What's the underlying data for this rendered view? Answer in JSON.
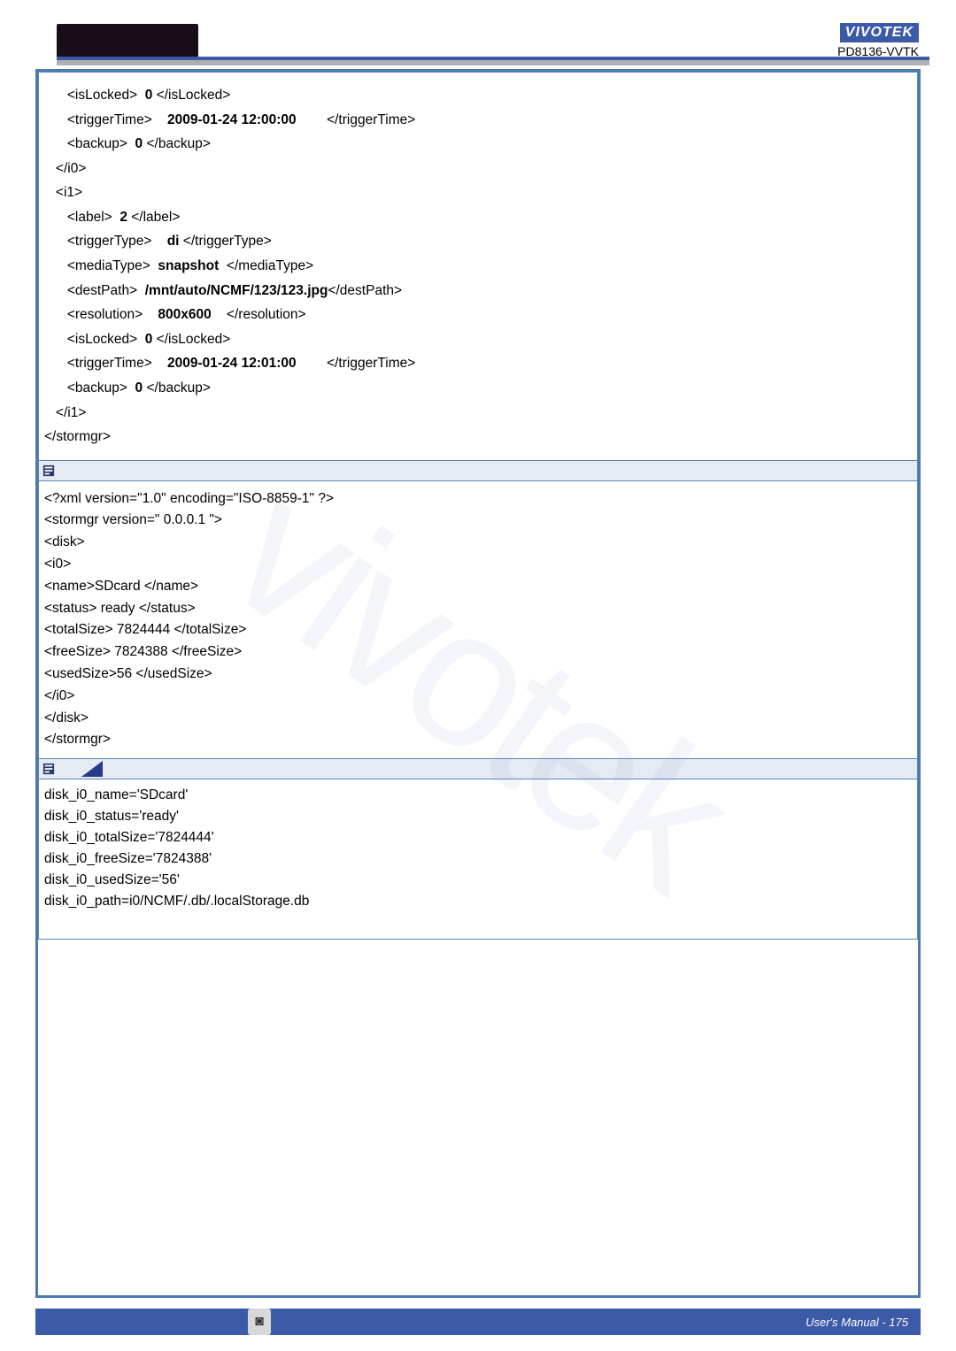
{
  "header": {
    "brand": "VIVOTEK",
    "model": "PD8136-VVTK"
  },
  "footer": {
    "text": "User's Manual - 175",
    "page_glyph": "◙"
  },
  "watermark": "vivotek",
  "box1": {
    "l1a": "      <isLocked>  ",
    "l1b": "0",
    "l1c": " </isLocked>",
    "l2a": "      <triggerTime>    ",
    "l2b": "2009-01-24 12:00:00",
    "l2c": "        </triggerTime>",
    "l3a": "      <backup>  ",
    "l3b": "0",
    "l3c": " </backup>",
    "l4": "   </i0>",
    "l5": "   <i1>",
    "l6a": "      <label>  ",
    "l6b": "2",
    "l6c": " </label>",
    "l7a": "      <triggerType>    ",
    "l7b": "di",
    "l7c": " </triggerType>",
    "l8a": "      <mediaType>  ",
    "l8b": "snapshot",
    "l8c": "  </mediaType>",
    "l9a": "      <destPath>  ",
    "l9b": "/mnt/auto/NCMF/123/123.jpg",
    "l9c": "</destPath>",
    "l10a": "      <resolution>    ",
    "l10b": "800x600",
    "l10c": "    </resolution>",
    "l11a": "      <isLocked>  ",
    "l11b": "0",
    "l11c": " </isLocked>",
    "l12a": "      <triggerTime>    ",
    "l12b": "2009-01-24 12:01:00",
    "l12c": "        </triggerTime>",
    "l13a": "      <backup>  ",
    "l13b": "0",
    "l13c": " </backup>",
    "l14": "   </i1>",
    "l15": "</stormgr>"
  },
  "box2": {
    "l1": "<?xml version=\"1.0\" encoding=\"ISO-8859-1\" ?>",
    "l2a": "<stormgr version=\"      ",
    "l2b": "0.0.0.1",
    "l2c": "   \">",
    "l3": "   <disk>",
    "l4": "     <i0>",
    "l5a": "      <name>",
    "l5b": "SDcard",
    "l5c": "      </name>",
    "l6a": "        <status>  ",
    "l6b": "ready",
    "l6c": "  </status>",
    "l7a": "        <totalSize>  ",
    "l7b": "7824444",
    "l7c": "      </totalSize>",
    "l8a": "        <freeSize>  ",
    "l8b": "7824388",
    "l8c": "      </freeSize>",
    "l9a": "        <usedSize>",
    "l9b": "56",
    "l9c": "      </usedSize>",
    "l10": "     </i0>",
    "l11": "   </disk>",
    "l12": "</stormgr>"
  },
  "box3": {
    "l1": "disk_i0_name='SDcard'",
    "l2": "disk_i0_status='ready'",
    "l3": "disk_i0_totalSize='7824444'",
    "l4": "disk_i0_freeSize='7824388'",
    "l5": "disk_i0_usedSize='56'",
    "l6": "disk_i0_path=i0/NCMF/.db/.localStorage.db"
  }
}
